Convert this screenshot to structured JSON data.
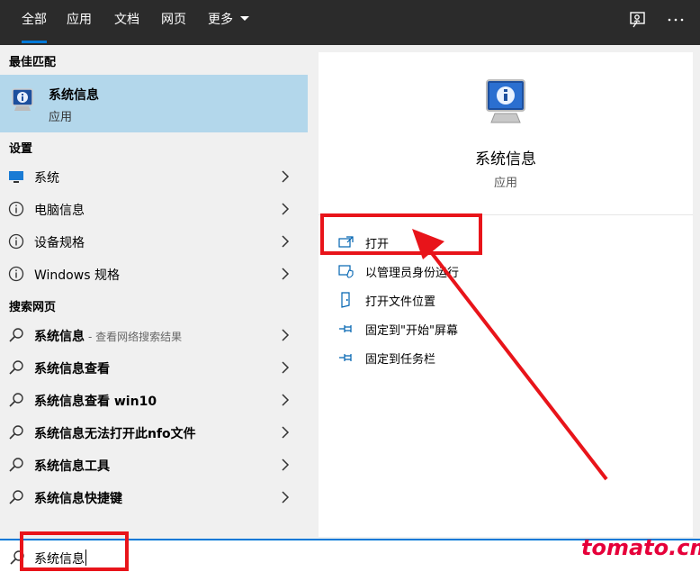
{
  "tabs": [
    {
      "label": "全部",
      "active": true
    },
    {
      "label": "应用"
    },
    {
      "label": "文档"
    },
    {
      "label": "网页"
    },
    {
      "label": "更多"
    }
  ],
  "topbar_icons": [
    "feedback-icon",
    "more-icon"
  ],
  "left": {
    "best_match_header": "最佳匹配",
    "best_match": {
      "title": "系统信息",
      "subtitle": "应用"
    },
    "settings_header": "设置",
    "settings_items": [
      {
        "label": "系统",
        "icon": "display-icon"
      },
      {
        "label": "电脑信息",
        "icon": "info-icon"
      },
      {
        "label": "设备规格",
        "icon": "info-icon"
      },
      {
        "label": "Windows 规格",
        "icon": "info-icon"
      }
    ],
    "web_header": "搜索网页",
    "web_items": [
      {
        "bold": "系统信息",
        "rest": "",
        "suffix": "- 查看网络搜索结果"
      },
      {
        "bold": "系统信息查看",
        "rest": "",
        "suffix": ""
      },
      {
        "bold": "系统信息查看 win10",
        "rest": "",
        "suffix": ""
      },
      {
        "bold": "系统信息无法打开此nfo文件",
        "rest": "",
        "suffix": ""
      },
      {
        "bold": "系统信息",
        "rest": "工具",
        "suffix": ""
      },
      {
        "bold": "系统信息快捷键",
        "rest": "",
        "suffix": ""
      }
    ]
  },
  "right": {
    "app_name": "系统信息",
    "app_type": "应用",
    "actions": [
      {
        "label": "打开",
        "icon": "open-icon"
      },
      {
        "label": "以管理员身份运行",
        "icon": "shield-icon"
      },
      {
        "label": "打开文件位置",
        "icon": "file-location-icon"
      },
      {
        "label": "固定到\"开始\"屏幕",
        "icon": "pin-icon"
      },
      {
        "label": "固定到任务栏",
        "icon": "pin-icon"
      }
    ]
  },
  "search": {
    "value": "系统信息"
  },
  "watermark": "tomato.cm",
  "colors": {
    "accent": "#0078d7",
    "selected": "#b3d7eb",
    "annotation": "#e8141a",
    "topbar": "#2b2b2b"
  }
}
